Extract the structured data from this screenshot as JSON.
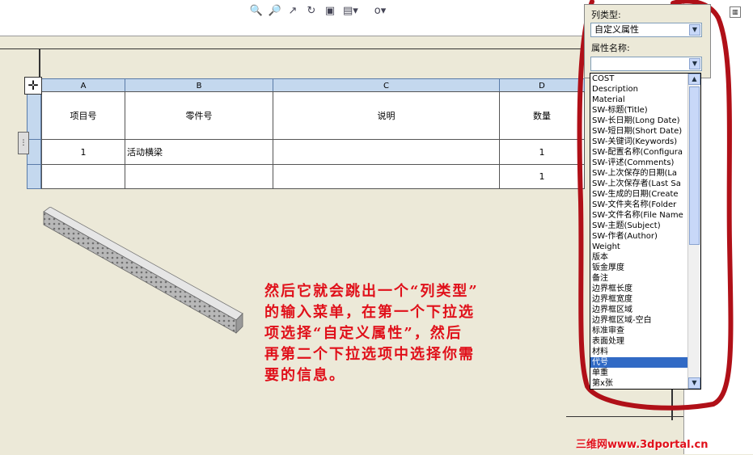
{
  "toolbar": {
    "icons": [
      "zoom-to-fit-icon",
      "zoom-area-icon",
      "select-icon",
      "rotate-icon",
      "display-icon",
      "view-orientation-icon",
      "hide-show-icon"
    ]
  },
  "table": {
    "columns": [
      "A",
      "B",
      "C",
      "D"
    ],
    "header": [
      "项目号",
      "零件号",
      "说明",
      "数量"
    ],
    "rows": [
      [
        "1",
        "活动横梁",
        "",
        "1"
      ],
      [
        "",
        "",
        "",
        "1"
      ]
    ]
  },
  "panel": {
    "column_type_label": "列类型:",
    "column_type_value": "自定义属性",
    "property_name_label": "属性名称:",
    "property_name_value": ""
  },
  "dropdown": {
    "options": [
      "COST",
      "Description",
      "Material",
      "SW-标题(Title)",
      "SW-长日期(Long Date)",
      "SW-短日期(Short Date)",
      "SW-关键词(Keywords)",
      "SW-配置名称(Configura",
      "SW-评述(Comments)",
      "SW-上次保存的日期(La",
      "SW-上次保存者(Last Sa",
      "SW-生成的日期(Create",
      "SW-文件夹名称(Folder",
      "SW-文件名称(File Name",
      "SW-主题(Subject)",
      "SW-作者(Author)",
      "Weight",
      "版本",
      "钣金厚度",
      "备注",
      "边界框长度",
      "边界框宽度",
      "边界框区域",
      "边界框区域-空白",
      "标准审查",
      "表面处理",
      "材料",
      "代号",
      "单重",
      "第x张"
    ],
    "selected_index": 27
  },
  "annotation": {
    "lines": [
      "然后它就会跳出一个“列类型”",
      "的输入菜单，在第一个下拉选",
      "项选择“自定义属性”，然后",
      "再第二个下拉选项中选择你需",
      "要的信息。"
    ]
  },
  "watermark": "三维网www.3dportal.cn",
  "colors": {
    "annotation_red": "#e0101a",
    "header_blue": "#c4d8ee",
    "selection_blue": "#316ac5"
  }
}
